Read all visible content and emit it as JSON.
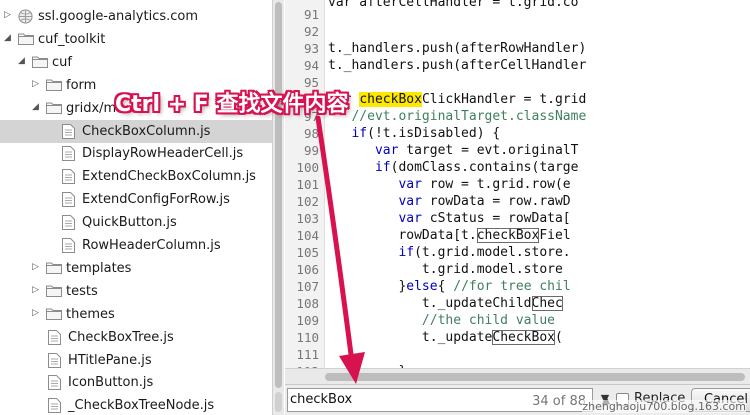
{
  "tree": {
    "items": [
      {
        "label": "ssl.google-analytics.com",
        "kind": "site",
        "depth": 0,
        "expanded": false,
        "selected": false
      },
      {
        "label": "cuf_toolkit",
        "kind": "folder",
        "depth": 0,
        "expanded": true,
        "selected": false
      },
      {
        "label": "cuf",
        "kind": "folder",
        "depth": 1,
        "expanded": true,
        "selected": false
      },
      {
        "label": "form",
        "kind": "folder",
        "depth": 2,
        "expanded": false,
        "selected": false
      },
      {
        "label": "gridx/m",
        "kind": "folder",
        "depth": 2,
        "expanded": true,
        "selected": false
      },
      {
        "label": "CheckBoxColumn.js",
        "kind": "file",
        "depth": 3,
        "selected": true
      },
      {
        "label": "DisplayRowHeaderCell.js",
        "kind": "file",
        "depth": 3,
        "selected": false
      },
      {
        "label": "ExtendCheckBoxColumn.js",
        "kind": "file",
        "depth": 3,
        "selected": false
      },
      {
        "label": "ExtendConfigForRow.js",
        "kind": "file",
        "depth": 3,
        "selected": false
      },
      {
        "label": "QuickButton.js",
        "kind": "file",
        "depth": 3,
        "selected": false
      },
      {
        "label": "RowHeaderColumn.js",
        "kind": "file",
        "depth": 3,
        "selected": false
      },
      {
        "label": "templates",
        "kind": "folder",
        "depth": 2,
        "expanded": false,
        "selected": false
      },
      {
        "label": "tests",
        "kind": "folder",
        "depth": 2,
        "expanded": false,
        "selected": false
      },
      {
        "label": "themes",
        "kind": "folder",
        "depth": 2,
        "expanded": false,
        "selected": false
      },
      {
        "label": "CheckBoxTree.js",
        "kind": "file",
        "depth": 2,
        "selected": false
      },
      {
        "label": "HTitlePane.js",
        "kind": "file",
        "depth": 2,
        "selected": false
      },
      {
        "label": "IconButton.js",
        "kind": "file",
        "depth": 2,
        "selected": false
      },
      {
        "label": "_CheckBoxTreeNode.js",
        "kind": "file",
        "depth": 2,
        "selected": false
      }
    ]
  },
  "editor": {
    "lines": [
      {
        "no": "91",
        "code": [
          [
            "",
            "var afterCellHandler = t.grid.co"
          ]
        ]
      },
      {
        "no": "92",
        "code": []
      },
      {
        "no": "93",
        "code": [
          [
            "",
            "t._handlers.push(afterRowHandler)"
          ]
        ]
      },
      {
        "no": "94",
        "code": [
          [
            "",
            "t._handlers.push(afterCellHandler"
          ]
        ]
      },
      {
        "no": "95",
        "code": []
      },
      {
        "no": "96",
        "code": [
          [
            "kw",
            "var "
          ],
          [
            "hl",
            "checkBox"
          ],
          [
            "",
            "ClickHandler = t.grid"
          ]
        ]
      },
      {
        "no": "97",
        "code": [
          [
            "cm",
            "   //evt.originalTarget.className"
          ]
        ]
      },
      {
        "no": "98",
        "code": [
          [
            "kw",
            "   if"
          ],
          [
            "",
            "(!t.isDisabled) {"
          ]
        ]
      },
      {
        "no": "99",
        "code": [
          [
            "kw",
            "      var "
          ],
          [
            "",
            "target = evt.originalT"
          ]
        ]
      },
      {
        "no": "100",
        "code": [
          [
            "kw",
            "      if"
          ],
          [
            "",
            "(domClass.contains(targe"
          ]
        ]
      },
      {
        "no": "101",
        "code": [
          [
            "kw",
            "         var "
          ],
          [
            "",
            "row = t.grid.row(e"
          ]
        ]
      },
      {
        "no": "102",
        "code": [
          [
            "kw",
            "         var "
          ],
          [
            "",
            "rowData = row.rawD"
          ]
        ]
      },
      {
        "no": "103",
        "code": [
          [
            "kw",
            "         var "
          ],
          [
            "",
            "cStatus = rowData["
          ]
        ]
      },
      {
        "no": "104",
        "code": [
          [
            "",
            "         rowData[t."
          ],
          [
            "box",
            "checkBox"
          ],
          [
            "",
            "Fiel"
          ]
        ]
      },
      {
        "no": "105",
        "code": [
          [
            "kw",
            "         if"
          ],
          [
            "",
            "(t.grid.model.store."
          ]
        ]
      },
      {
        "no": "106",
        "code": [
          [
            "",
            "            t.grid.model.store"
          ]
        ]
      },
      {
        "no": "107",
        "code": [
          [
            "",
            "         }"
          ],
          [
            "kw",
            "else"
          ],
          [
            "",
            "{ "
          ],
          [
            "cm",
            "//for tree chil"
          ]
        ]
      },
      {
        "no": "108",
        "code": [
          [
            "",
            "            t._updateChild"
          ],
          [
            "box",
            "Chec"
          ]
        ]
      },
      {
        "no": "109",
        "code": [
          [
            "cm",
            "            //the child value"
          ]
        ]
      },
      {
        "no": "110",
        "code": [
          [
            "",
            "            t._update"
          ],
          [
            "box",
            "CheckBox"
          ],
          [
            "",
            "("
          ]
        ]
      },
      {
        "no": "111",
        "code": []
      },
      {
        "no": "112",
        "code": [
          [
            "",
            "         }"
          ]
        ]
      }
    ]
  },
  "findbar": {
    "query": "checkBox",
    "count": "34 of 88",
    "replace_label": "Replace",
    "cancel_label": "Cancel"
  },
  "annotation": {
    "text": "Ctrl + F 查找文件内容",
    "color": "#d8124f"
  },
  "watermark": "zhenghaoju700.blog.163.com",
  "colors": {
    "selection": "#d4d4d4",
    "keyword": "#0000c0",
    "comment": "#3f7f5f",
    "match_highlight": "#ffe800"
  }
}
